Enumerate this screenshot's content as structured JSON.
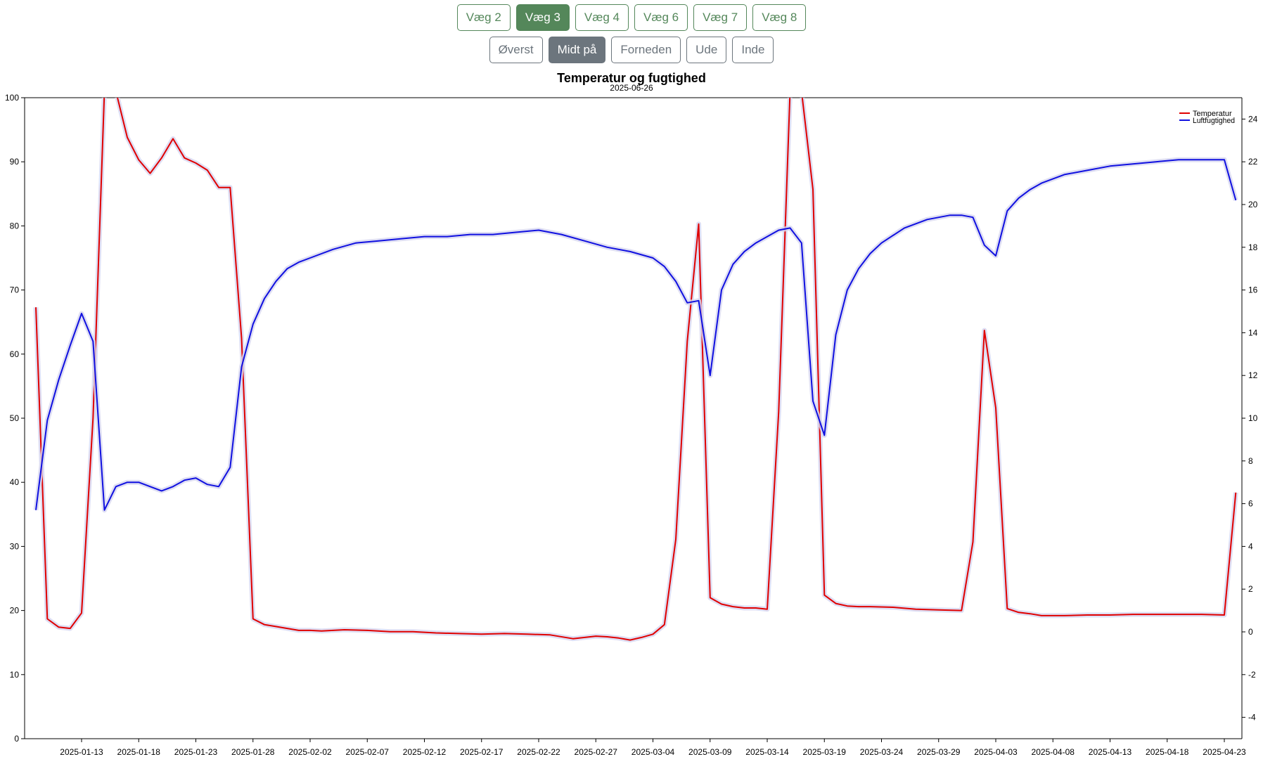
{
  "wall_buttons": [
    {
      "label": "Væg 2",
      "active": false
    },
    {
      "label": "Væg 3",
      "active": true
    },
    {
      "label": "Væg 4",
      "active": false
    },
    {
      "label": "Væg 6",
      "active": false
    },
    {
      "label": "Væg 7",
      "active": false
    },
    {
      "label": "Væg 8",
      "active": false
    }
  ],
  "position_buttons": [
    {
      "label": "Øverst",
      "active": false
    },
    {
      "label": "Midt på",
      "active": true
    },
    {
      "label": "Forneden",
      "active": false
    },
    {
      "label": "Ude",
      "active": false
    },
    {
      "label": "Inde",
      "active": false
    }
  ],
  "colors": {
    "accent_green": "#54875a",
    "secondary_gray": "#6c757d",
    "temperature": "#e00000",
    "humidity": "#1010e0",
    "band": "#d6d6f0"
  },
  "chart_data": {
    "type": "line",
    "title": "Temperatur og fugtighed",
    "subtitle": "2025-06-26",
    "x_ticks": [
      "2025-01-13",
      "2025-01-18",
      "2025-01-23",
      "2025-01-28",
      "2025-02-02",
      "2025-02-07",
      "2025-02-12",
      "2025-02-17",
      "2025-02-22",
      "2025-02-27",
      "2025-03-04",
      "2025-03-09",
      "2025-03-14",
      "2025-03-19",
      "2025-03-24",
      "2025-03-29",
      "2025-04-03",
      "2025-04-08",
      "2025-04-13",
      "2025-04-18",
      "2025-04-23"
    ],
    "x_start": "2025-01-09",
    "x_range": [
      "2025-01-09",
      "2025-04-24"
    ],
    "y_left": {
      "range": [
        0,
        100
      ],
      "ticks": [
        0,
        10,
        20,
        30,
        40,
        50,
        60,
        70,
        80,
        90,
        100
      ]
    },
    "y_right": {
      "range": [
        -5,
        25
      ],
      "ticks": [
        -4,
        -2,
        0,
        2,
        4,
        6,
        8,
        10,
        12,
        14,
        16,
        18,
        20,
        22,
        24
      ]
    },
    "legend_position": "top-right",
    "series": [
      {
        "name": "Temperatur",
        "axis": "left",
        "color": "#e00000",
        "x": [
          "2025-01-09",
          "2025-01-10",
          "2025-01-11",
          "2025-01-12",
          "2025-01-13",
          "2025-01-14",
          "2025-01-15",
          "2025-01-16",
          "2025-01-17",
          "2025-01-18",
          "2025-01-19",
          "2025-01-20",
          "2025-01-21",
          "2025-01-22",
          "2025-01-23",
          "2025-01-24",
          "2025-01-25",
          "2025-01-26",
          "2025-01-27",
          "2025-01-28",
          "2025-01-29",
          "2025-01-30",
          "2025-01-31",
          "2025-02-01",
          "2025-02-02",
          "2025-02-03",
          "2025-02-05",
          "2025-02-07",
          "2025-02-09",
          "2025-02-11",
          "2025-02-13",
          "2025-02-15",
          "2025-02-17",
          "2025-02-19",
          "2025-02-21",
          "2025-02-23",
          "2025-02-25",
          "2025-02-27",
          "2025-02-28",
          "2025-03-01",
          "2025-03-02",
          "2025-03-03",
          "2025-03-04",
          "2025-03-05",
          "2025-03-06",
          "2025-03-07",
          "2025-03-08",
          "2025-03-09",
          "2025-03-10",
          "2025-03-11",
          "2025-03-12",
          "2025-03-13",
          "2025-03-14",
          "2025-03-15",
          "2025-03-16",
          "2025-03-17",
          "2025-03-18",
          "2025-03-19",
          "2025-03-20",
          "2025-03-21",
          "2025-03-22",
          "2025-03-23",
          "2025-03-25",
          "2025-03-27",
          "2025-03-29",
          "2025-03-31",
          "2025-04-01",
          "2025-04-02",
          "2025-04-03",
          "2025-04-04",
          "2025-04-05",
          "2025-04-06",
          "2025-04-07",
          "2025-04-09",
          "2025-04-11",
          "2025-04-13",
          "2025-04-15",
          "2025-04-17",
          "2025-04-19",
          "2025-04-21",
          "2025-04-23",
          "2025-04-24"
        ],
        "y": [
          67.3,
          18.7,
          17.4,
          17.2,
          19.6,
          50.0,
          101.0,
          101.0,
          93.8,
          90.3,
          88.2,
          90.6,
          93.6,
          90.6,
          89.8,
          88.7,
          86.0,
          86.0,
          62.5,
          18.7,
          17.8,
          17.5,
          17.2,
          16.9,
          16.9,
          16.8,
          17.0,
          16.9,
          16.7,
          16.7,
          16.5,
          16.4,
          16.3,
          16.4,
          16.3,
          16.2,
          15.6,
          16.0,
          15.9,
          15.7,
          15.4,
          15.8,
          16.3,
          17.8,
          31.1,
          62.0,
          80.3,
          22.0,
          21.0,
          20.6,
          20.4,
          20.4,
          20.2,
          51.0,
          101.0,
          101.0,
          85.7,
          22.4,
          21.1,
          20.7,
          20.6,
          20.6,
          20.5,
          20.2,
          20.1,
          20.0,
          30.7,
          63.7,
          51.6,
          20.3,
          19.7,
          19.5,
          19.2,
          19.2,
          19.3,
          19.3,
          19.4,
          19.4,
          19.4,
          19.4,
          19.3,
          38.4
        ]
      },
      {
        "name": "Luftfugtighed",
        "axis": "right",
        "color": "#1010e0",
        "x": [
          "2025-01-09",
          "2025-01-10",
          "2025-01-11",
          "2025-01-12",
          "2025-01-13",
          "2025-01-14",
          "2025-01-15",
          "2025-01-16",
          "2025-01-17",
          "2025-01-18",
          "2025-01-19",
          "2025-01-20",
          "2025-01-21",
          "2025-01-22",
          "2025-01-23",
          "2025-01-24",
          "2025-01-25",
          "2025-01-26",
          "2025-01-27",
          "2025-01-28",
          "2025-01-29",
          "2025-01-30",
          "2025-01-31",
          "2025-02-01",
          "2025-02-02",
          "2025-02-04",
          "2025-02-06",
          "2025-02-08",
          "2025-02-10",
          "2025-02-12",
          "2025-02-14",
          "2025-02-16",
          "2025-02-18",
          "2025-02-20",
          "2025-02-22",
          "2025-02-24",
          "2025-02-26",
          "2025-02-28",
          "2025-03-02",
          "2025-03-04",
          "2025-03-05",
          "2025-03-06",
          "2025-03-07",
          "2025-03-08",
          "2025-03-09",
          "2025-03-10",
          "2025-03-11",
          "2025-03-12",
          "2025-03-13",
          "2025-03-14",
          "2025-03-15",
          "2025-03-16",
          "2025-03-17",
          "2025-03-18",
          "2025-03-19",
          "2025-03-20",
          "2025-03-21",
          "2025-03-22",
          "2025-03-23",
          "2025-03-24",
          "2025-03-26",
          "2025-03-28",
          "2025-03-30",
          "2025-03-31",
          "2025-04-01",
          "2025-04-02",
          "2025-04-03",
          "2025-04-04",
          "2025-04-05",
          "2025-04-06",
          "2025-04-07",
          "2025-04-09",
          "2025-04-11",
          "2025-04-13",
          "2025-04-15",
          "2025-04-17",
          "2025-04-19",
          "2025-04-21",
          "2025-04-23",
          "2025-04-24"
        ],
        "y": [
          5.7,
          9.9,
          11.8,
          13.4,
          14.9,
          13.6,
          5.7,
          6.8,
          7.0,
          7.0,
          6.8,
          6.6,
          6.8,
          7.1,
          7.2,
          6.9,
          6.8,
          7.7,
          12.4,
          14.4,
          15.6,
          16.4,
          17.0,
          17.3,
          17.5,
          17.9,
          18.2,
          18.3,
          18.4,
          18.5,
          18.5,
          18.6,
          18.6,
          18.7,
          18.8,
          18.6,
          18.3,
          18.0,
          17.8,
          17.5,
          17.1,
          16.4,
          15.4,
          15.5,
          12.0,
          16.0,
          17.2,
          17.8,
          18.2,
          18.5,
          18.8,
          18.9,
          18.2,
          10.8,
          9.2,
          13.9,
          16.0,
          17.0,
          17.7,
          18.2,
          18.9,
          19.3,
          19.5,
          19.5,
          19.4,
          18.1,
          17.6,
          19.7,
          20.3,
          20.7,
          21.0,
          21.4,
          21.6,
          21.8,
          21.9,
          22.0,
          22.1,
          22.1,
          22.1,
          20.2
        ]
      }
    ]
  }
}
